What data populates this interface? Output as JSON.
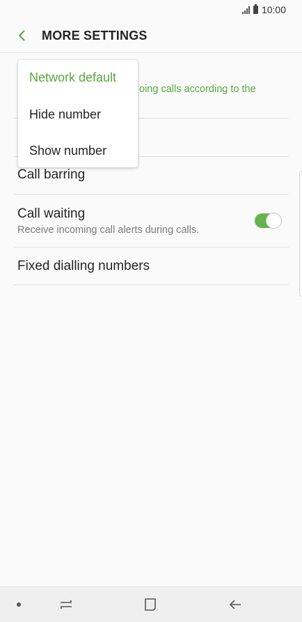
{
  "status_bar": {
    "time": "10:00"
  },
  "header": {
    "title": "MORE SETTINGS"
  },
  "settings": {
    "caller_id_sub": "oing calls according to the",
    "call_barring": "Call barring",
    "call_waiting": {
      "title": "Call waiting",
      "subtitle": "Receive incoming call alerts during calls.",
      "enabled": true
    },
    "fixed_dialling": "Fixed dialling numbers"
  },
  "dropdown": {
    "options": [
      "Network default",
      "Hide number",
      "Show number"
    ],
    "selected": "Network default"
  },
  "colors": {
    "accent": "#58a83e",
    "toggle_on": "#66b34d"
  }
}
